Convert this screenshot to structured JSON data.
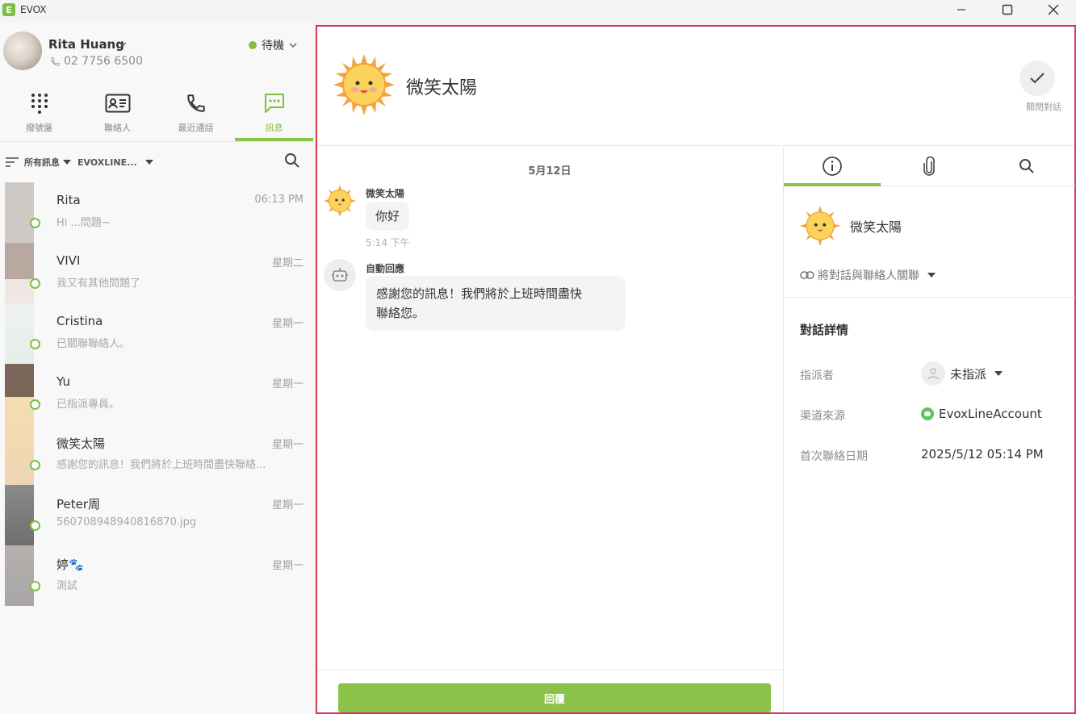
{
  "app": {
    "name": "EVOX",
    "logo_letter": "E"
  },
  "user": {
    "name": "Rita Huang",
    "phone": "02 7756 6500",
    "status": "待機"
  },
  "nav": [
    {
      "label": "撥號盤",
      "icon": "dialpad-icon"
    },
    {
      "label": "聯絡人",
      "icon": "contact-card-icon"
    },
    {
      "label": "最近通話",
      "icon": "phone-icon"
    },
    {
      "label": "訊息",
      "icon": "message-icon",
      "active": true
    }
  ],
  "filters": {
    "scope": "所有訊息",
    "account": "EVOXLINE..."
  },
  "conversations": [
    {
      "name": "Rita",
      "time": "06:13 PM",
      "snippet": "Hi ...問題~",
      "thumb": "#cfc9c6"
    },
    {
      "name": "VIVI",
      "time": "星期二",
      "snippet": "我又有其他問題了",
      "thumb": "#b8a8a0"
    },
    {
      "name": "Cristina",
      "time": "星期一",
      "snippet": "已關聯聯絡人。",
      "thumb": "#e9eeea"
    },
    {
      "name": "Yu",
      "time": "星期一",
      "snippet": "已指派專員。",
      "thumb": "#7a6658"
    },
    {
      "name": "微笑太陽",
      "time": "星期一",
      "snippet": "感謝您的訊息！我們將於上班時間盡快聯絡...",
      "thumb": "#f1d8ac"
    },
    {
      "name": "Peter周",
      "time": "星期一",
      "snippet": "560708948940816870.jpg",
      "thumb": "#7b7b7b"
    },
    {
      "name": "婷🐾",
      "time": "星期一",
      "snippet": "測試",
      "thumb": "#b5b0ae"
    }
  ],
  "conversation": {
    "title": "微笑太陽",
    "close_label": "關閉對話",
    "date": "5月12日",
    "messages": [
      {
        "sender": "微笑太陽",
        "text": "你好",
        "time": "5:14 下午"
      },
      {
        "sender": "自動回應",
        "text_line1": "感謝您的訊息！我們將於上班時間盡快",
        "text_line2": "聯絡您。"
      }
    ],
    "reply_label": "回覆"
  },
  "side": {
    "contact_name": "微笑太陽",
    "link_label": "將對話與聯絡人關聯",
    "details_title": "對話詳情",
    "assignee_label": "指派者",
    "assignee_value": "未指派",
    "channel_label": "渠道來源",
    "channel_value": "EvoxLineAccount",
    "first_contact_label": "首次聯絡日期",
    "first_contact_value": "2025/5/12 05:14 PM"
  },
  "colors": {
    "accent": "#8bc34a",
    "highlight_border": "#d23a54"
  }
}
